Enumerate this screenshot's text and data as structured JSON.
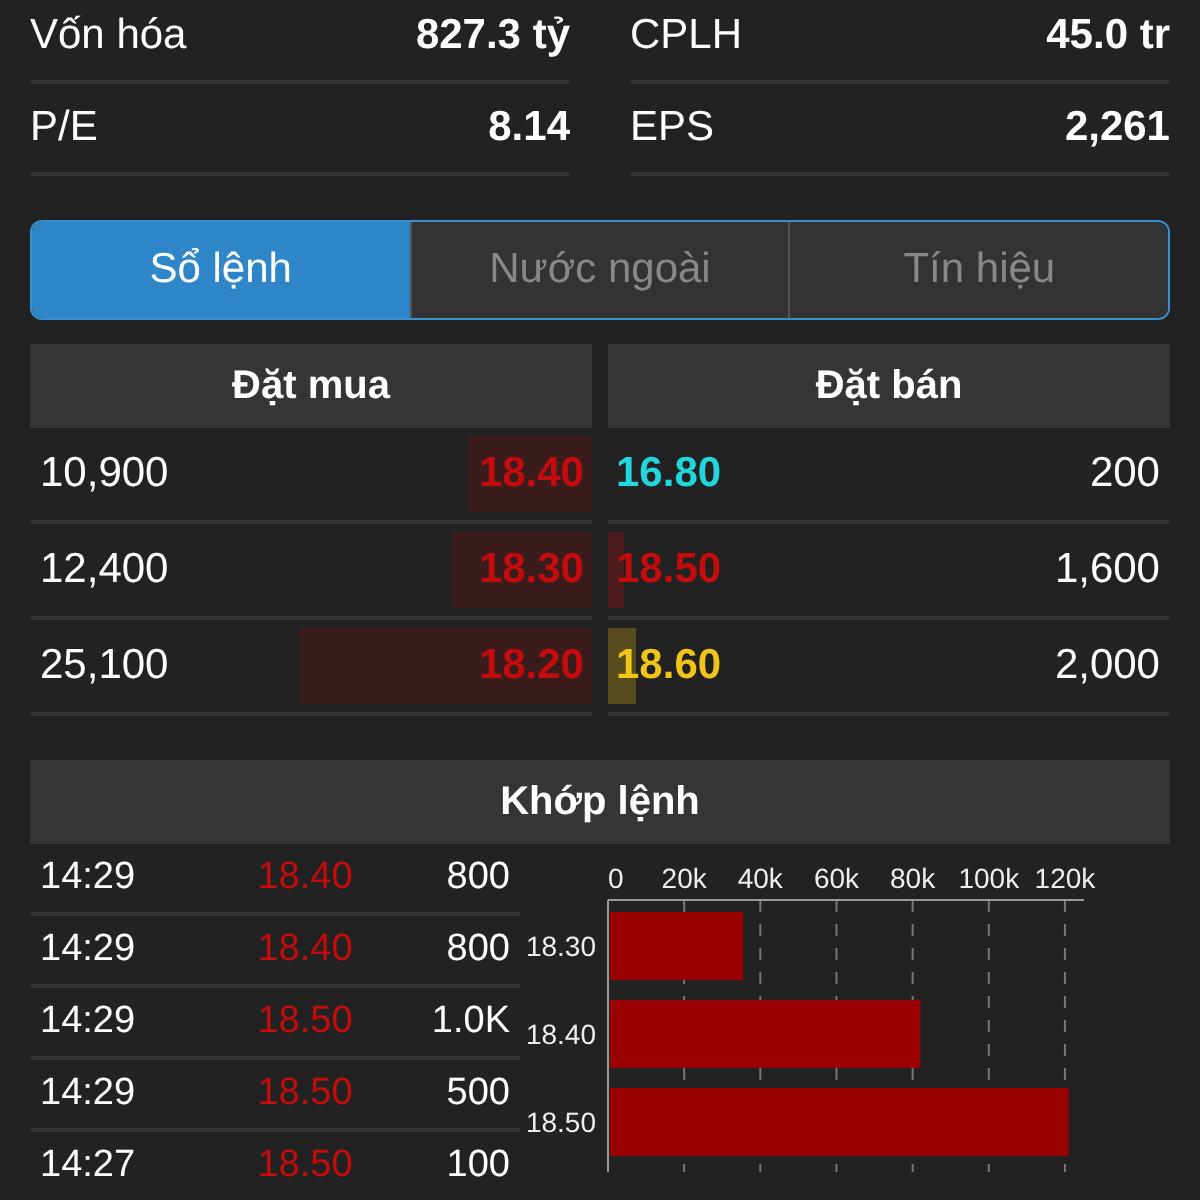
{
  "stats": [
    {
      "label": "Vốn hóa",
      "value": "827.3 tỷ"
    },
    {
      "label": "CPLH",
      "value": "45.0 tr"
    },
    {
      "label": "P/E",
      "value": "8.14"
    },
    {
      "label": "EPS",
      "value": "2,261"
    }
  ],
  "tabs": [
    {
      "label": "Sổ lệnh",
      "selected": true
    },
    {
      "label": "Nước ngoài",
      "selected": false
    },
    {
      "label": "Tín hiệu",
      "selected": false
    }
  ],
  "order_book": {
    "bid_title": "Đặt mua",
    "ask_title": "Đặt bán",
    "rows": [
      {
        "bid": {
          "volume": "10,900",
          "price": "18.40",
          "color": "#c40c0c",
          "level": 0.22
        },
        "ask": {
          "price": "16.80",
          "color": "#22d6dc",
          "volume": "200"
        }
      },
      {
        "bid": {
          "volume": "12,400",
          "price": "18.30",
          "color": "#c40c0c",
          "level": 0.25
        },
        "ask": {
          "price": "18.50",
          "color": "#c40c0c",
          "level": 0.03,
          "volume": "1,600"
        }
      },
      {
        "bid": {
          "volume": "25,100",
          "price": "18.20",
          "color": "#c40c0c",
          "level": 0.52
        },
        "ask": {
          "price": "18.60",
          "color": "#f0c419",
          "level": 0.05,
          "volume": "2,000"
        }
      }
    ]
  },
  "matched": {
    "title": "Khớp lệnh",
    "trades": [
      {
        "time": "14:29",
        "price": "18.40",
        "color": "#c40c0c",
        "volume": "800"
      },
      {
        "time": "14:29",
        "price": "18.40",
        "color": "#c40c0c",
        "volume": "800"
      },
      {
        "time": "14:29",
        "price": "18.50",
        "color": "#c40c0c",
        "volume": "1.0K"
      },
      {
        "time": "14:29",
        "price": "18.50",
        "color": "#c40c0c",
        "volume": "500"
      },
      {
        "time": "14:27",
        "price": "18.50",
        "color": "#c40c0c",
        "volume": "100"
      }
    ],
    "chart_data": {
      "type": "bar",
      "orientation": "horizontal",
      "grid": true,
      "categories": [
        "18.30",
        "18.40",
        "18.50"
      ],
      "series": [
        {
          "color": "#9a0000",
          "values": [
            35500,
            82000,
            121000
          ]
        }
      ],
      "xlim": [
        0,
        125000
      ],
      "xticks": [
        {
          "value": 0,
          "label": "0"
        },
        {
          "value": 20000,
          "label": "20k"
        },
        {
          "value": 40000,
          "label": "40k"
        },
        {
          "value": 60000,
          "label": "60k"
        },
        {
          "value": 80000,
          "label": "80k"
        },
        {
          "value": 100000,
          "label": "100k"
        },
        {
          "value": 120000,
          "label": "120k"
        }
      ]
    }
  }
}
